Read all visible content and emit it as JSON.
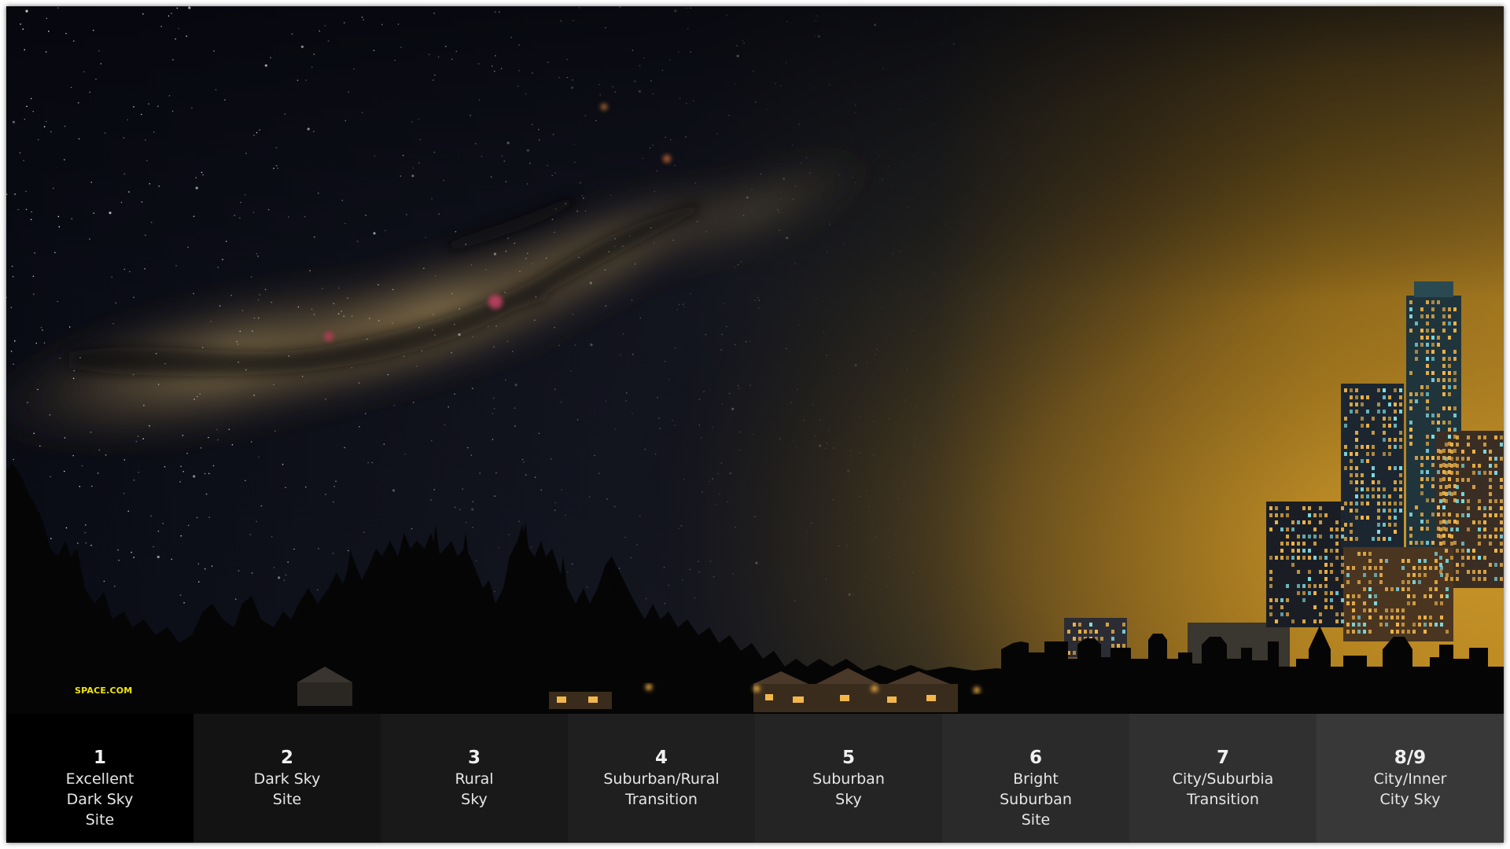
{
  "watermark": "SPACE.COM",
  "colors": {
    "sky_dark": "#0b0d18",
    "milky_way_core": "#a08a5a",
    "city_glow": "#d9a12a",
    "silhouette": "#050505",
    "window_light": "#f2b64a",
    "watermark": "#f2e70a"
  },
  "bortle_scale": [
    {
      "number": "1",
      "label": "Excellent\nDark Sky\nSite",
      "color": "#000000"
    },
    {
      "number": "2",
      "label": "Dark Sky\nSite",
      "color": "#131313"
    },
    {
      "number": "3",
      "label": "Rural\nSky",
      "color": "#191919"
    },
    {
      "number": "4",
      "label": "Suburban/Rural\nTransition",
      "color": "#1f1f1f"
    },
    {
      "number": "5",
      "label": "Suburban\nSky",
      "color": "#242424"
    },
    {
      "number": "6",
      "label": "Bright\nSuburban\nSite",
      "color": "#2a2a2a"
    },
    {
      "number": "7",
      "label": "City/Suburbia\nTransition",
      "color": "#303030"
    },
    {
      "number": "8/9",
      "label": "City/Inner\nCity Sky",
      "color": "#383838"
    }
  ]
}
